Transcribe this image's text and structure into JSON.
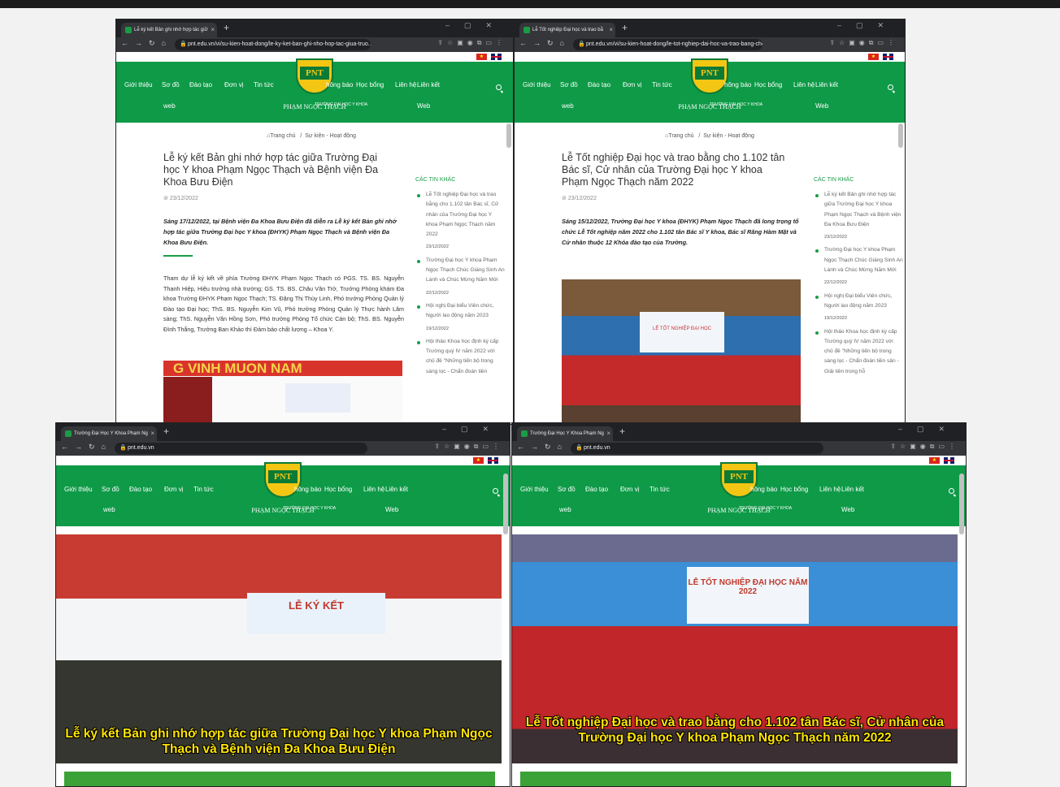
{
  "colors": {
    "green": "#0e9a47",
    "accent": "#1a9c47",
    "caption": "#ffe400"
  },
  "site": {
    "nav_left": [
      "Giới thiệu",
      "Sơ đồ",
      "Đào tạo",
      "Đơn vị",
      "Tin tức"
    ],
    "nav_left_sub": "web",
    "nav_right": [
      "hông báo",
      "Học bổng",
      "Liên hệ",
      "Liên kết"
    ],
    "nav_right_sub": "Web",
    "logo_text": "PNT",
    "school_line1": "TRƯỜNG ĐẠI HỌC Y KHOA",
    "school_line2": "PHẠM NGỌC THẠCH",
    "flag_vn": "★",
    "icons": [
      "search-icon",
      "vietnam-flag-icon",
      "uk-flag-icon"
    ]
  },
  "win1": {
    "tab": "Lễ ký kết Bản ghi nhớ hợp tác giữ",
    "url": "pnt.edu.vn/vi/su-kien-hoat-dong/le-ky-ket-ban-ghi-nho-hop-tac-giua-truo...",
    "crumb_home": "Trang chủ",
    "crumb_sep": "/",
    "crumb_cat": "Sự kiện - Hoạt động",
    "title": "Lễ ký kết Bản ghi nhớ hợp tác giữa Trường Đại học Y khoa Phạm Ngọc Thạch và Bệnh viện Đa Khoa Bưu Điện",
    "date": "23/12/2022",
    "lead": "Sáng 17/12/2022, tại Bệnh viện Đa Khoa Bưu Điện đã diễn ra Lễ ký kết Bản ghi nhớ hợp tác giữa Trường Đại học Y khoa (ĐHYK) Phạm Ngọc Thạch và Bệnh viện Đa Khoa Bưu Điện.",
    "body": "Tham dự lễ ký kết về phía Trường ĐHYK Phạm Ngọc Thạch có PGS. TS. BS. Nguyễn Thanh Hiệp, Hiệu trưởng nhà trường; GS. TS. BS. Châu Văn Trở, Trưởng Phòng khám Đa khoa Trường ĐHYK Phạm Ngọc Thạch; TS. Đặng Thị Thùy Linh, Phó trưởng Phòng Quản lý Đào tạo Đại học; ThS. BS. Nguyễn Kim Vũ, Phó trưởng Phòng Quản lý Thực hành Lâm sàng; ThS. Nguyễn Văn Hồng Sơn, Phó trưởng Phòng Tổ chức Cán bộ; ThS. BS. Nguyễn Đình Thắng, Trưởng Ban Khảo thí Đảm bảo chất lượng – Khoa Y.",
    "photo_text": "G VINH MUON NAM",
    "side_header": "CÁC TIN KHÁC",
    "side": [
      {
        "t": "Lễ Tốt nghiệp Đại học và trao bằng cho 1.102 tân Bác sĩ, Cử nhân của Trường Đại học Y khoa Phạm Ngọc Thạch năm 2022",
        "d": "23/12/2022"
      },
      {
        "t": "Trường Đại học Y khoa Phạm Ngọc Thạch Chúc Giáng Sinh An Lành và Chúc Mừng Năm Mới",
        "d": "22/12/2022"
      },
      {
        "t": "Hội nghị Đại biểu Viên chức, Người lao động năm 2023",
        "d": "19/12/2022"
      },
      {
        "t": "Hội thảo Khoa học định kỳ cấp Trường quý IV năm 2022 với chủ đề \"Những tiến bộ trong sàng lọc - Chẩn đoán tiền",
        "d": ""
      }
    ]
  },
  "win2": {
    "tab": "Lễ Tốt nghiệp Đại học và trao bằ",
    "url": "pnt.edu.vn/vi/su-kien-hoat-dong/le-tot-nghiep-dai-hoc-va-trao-bang-cho-...",
    "crumb_home": "Trang chủ",
    "crumb_sep": "/",
    "crumb_cat": "Sự kiện - Hoạt động",
    "title": "Lễ Tốt nghiệp Đại học và trao bằng cho 1.102 tân Bác sĩ, Cử nhân của Trường Đại học Y khoa Phạm Ngọc Thạch năm 2022",
    "date": "23/12/2022",
    "lead": "Sáng 15/12/2022, Trường Đại học Y khoa (ĐHYK) Phạm Ngọc Thạch đã long trọng tổ chức Lễ Tốt nghiệp năm 2022 cho 1.102 tân Bác sĩ Y khoa, Bác sĩ Răng Hàm Mặt và Cử nhân thuộc 12 Khóa đào tạo của Trường.",
    "photo_text": "LỄ TỐT NGHIỆP ĐẠI HỌC",
    "side_header": "CÁC TIN KHÁC",
    "side": [
      {
        "t": "Lễ ký kết Bản ghi nhớ hợp tác giữa Trường Đại học Y khoa Phạm Ngọc Thạch và Bệnh viện Đa Khoa Bưu Điện",
        "d": "23/12/2022"
      },
      {
        "t": "Trường Đại học Y khoa Phạm Ngọc Thạch Chúc Giáng Sinh An Lành và Chúc Mừng Năm Mới",
        "d": "22/12/2022"
      },
      {
        "t": "Hội nghị Đại biểu Viên chức, Người lao động năm 2023",
        "d": "19/12/2022"
      },
      {
        "t": "Hội thảo Khoa học định kỳ cấp Trường quý IV năm 2022 với chủ đề \"Những tiến bộ trong sàng lọc - Chẩn đoán tiền sản - Giải tiền trong hỗ",
        "d": ""
      }
    ]
  },
  "win3": {
    "tab": "Trường Đại Học Y Khoa Phạm Ng",
    "url": "pnt.edu.vn",
    "photo_text": "LỄ KÝ KẾT",
    "caption": "Lễ ký kết Bản ghi nhớ hợp tác giữa Trường Đại học Y khoa Phạm Ngọc Thạch và Bệnh viện Đa Khoa Bưu Điện"
  },
  "win4": {
    "tab": "Trường Đại Học Y Khoa Phạm Ng",
    "url": "pnt.edu.vn",
    "photo_text": "LỄ TỐT NGHIỆP ĐẠI HỌC NĂM 2022",
    "caption": "Lễ Tốt nghiệp Đại học và trao bằng cho 1.102 tân Bác sĩ, Cử nhân của Trường Đại học Y khoa Phạm Ngọc Thạch năm 2022"
  }
}
